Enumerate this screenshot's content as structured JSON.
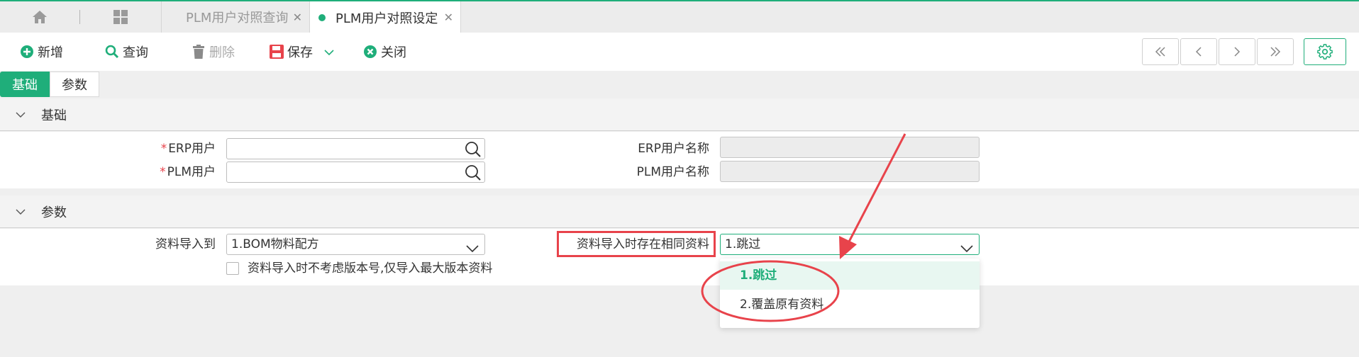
{
  "tabs": [
    {
      "label": "PLM用户对照查询",
      "active": false
    },
    {
      "label": "PLM用户对照设定",
      "active": true
    }
  ],
  "toolbar": {
    "new_label": "新增",
    "query_label": "查询",
    "delete_label": "删除",
    "save_label": "保存",
    "close_label": "关闭"
  },
  "subtabs": [
    {
      "label": "基础",
      "active": true
    },
    {
      "label": "参数",
      "active": false
    }
  ],
  "basic": {
    "title": "基础",
    "erp_user_label": "ERP用户",
    "erp_user_value": "",
    "plm_user_label": "PLM用户",
    "plm_user_value": "",
    "erp_user_name_label": "ERP用户名称",
    "erp_user_name_value": "",
    "plm_user_name_label": "PLM用户名称",
    "plm_user_name_value": "",
    "required_mark": "*"
  },
  "params": {
    "title": "参数",
    "import_to_label": "资料导入到",
    "import_to_value": "1.BOM物料配方",
    "same_data_label": "资料导入时存在相同资料",
    "same_data_value": "1.跳过",
    "ignore_version_label": "资料导入时不考虑版本号,仅导入最大版本资料",
    "ignore_version_checked": false,
    "options": [
      "1.跳过",
      "2.覆盖原有资料"
    ]
  },
  "colors": {
    "accent": "#1fae7a",
    "highlight": "#e8434b"
  }
}
